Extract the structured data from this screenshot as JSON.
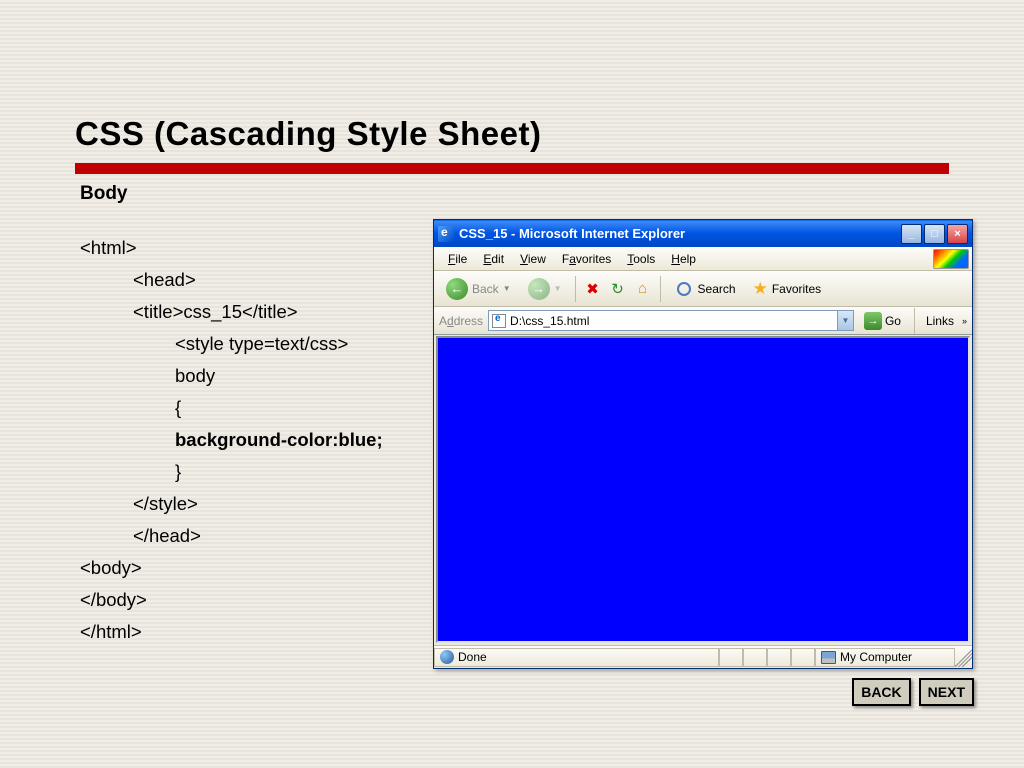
{
  "slide": {
    "title": "CSS (Cascading Style Sheet)",
    "subtitle": "Body"
  },
  "code": {
    "l1": "<html>",
    "l2": "<head>",
    "l3": "<title>css_15</title>",
    "l4": "<style type=text/css>",
    "l5": "body",
    "l6": "{",
    "l7": "background-color:blue;",
    "l8": "}",
    "l9": "</style>",
    "l10": "</head>",
    "l11": "<body>",
    "l12": "</body>",
    "l13": "</html>"
  },
  "ie": {
    "title": "CSS_15 - Microsoft Internet Explorer",
    "menu": {
      "file": "File",
      "edit": "Edit",
      "view": "View",
      "favorites": "Favorites",
      "tools": "Tools",
      "help": "Help"
    },
    "toolbar": {
      "back": "Back",
      "search": "Search",
      "favorites": "Favorites"
    },
    "address": {
      "label": "Address",
      "value": "D:\\css_15.html",
      "go": "Go",
      "links": "Links"
    },
    "status": {
      "done": "Done",
      "zone": "My Computer"
    }
  },
  "nav": {
    "back": "BACK",
    "next": "NEXT"
  }
}
